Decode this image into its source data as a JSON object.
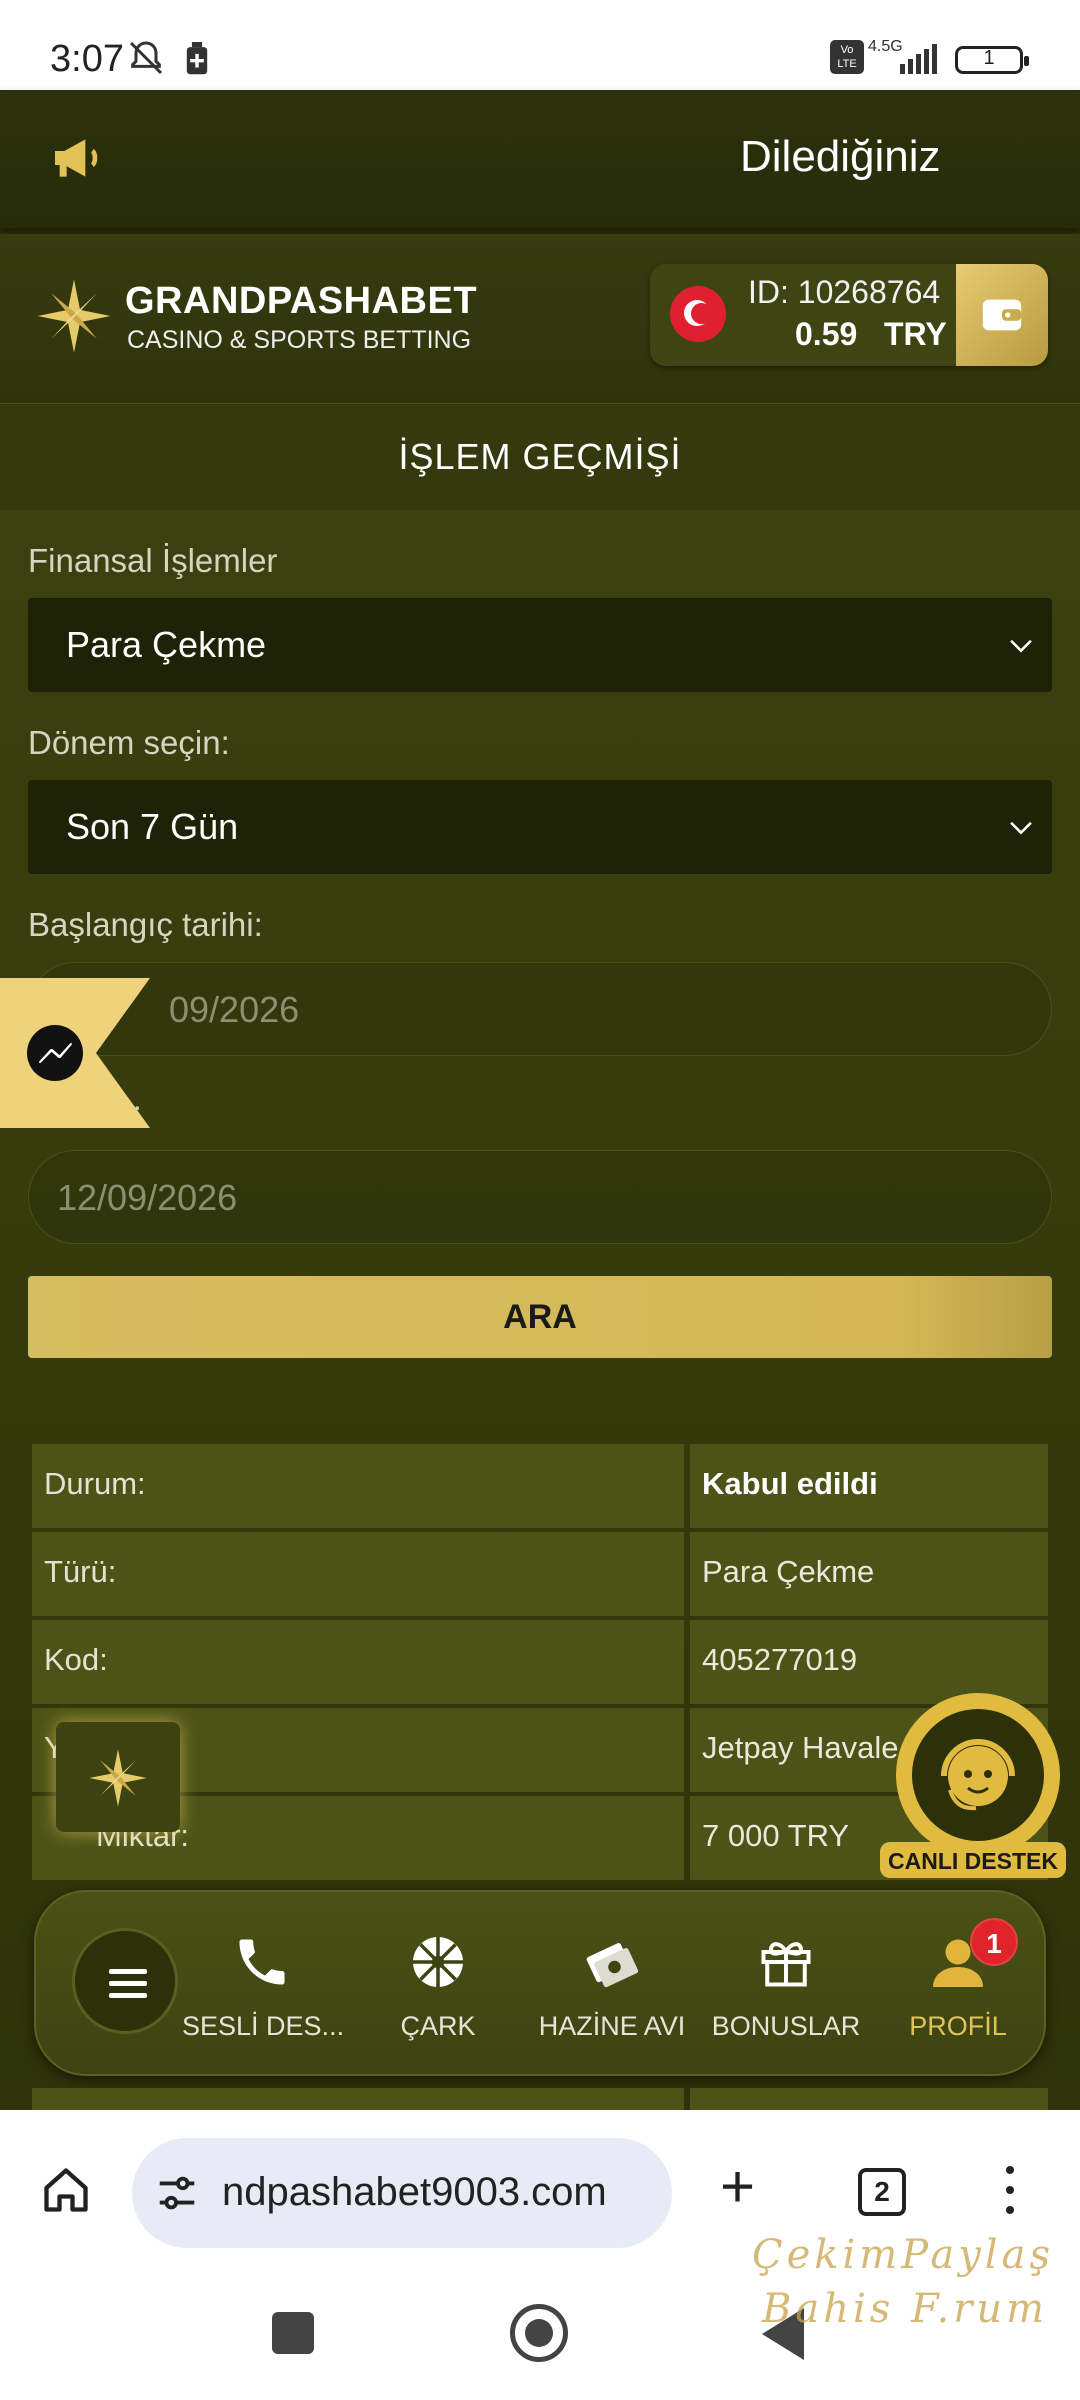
{
  "status_bar": {
    "time": "3:07",
    "network": "4.5G",
    "volte": "Vo LTE",
    "battery": "1"
  },
  "announcement": {
    "text": "Dilediğiniz"
  },
  "header": {
    "brand": "GRANDPASHABET",
    "tagline": "CASINO & SPORTS BETTING",
    "account_id": "ID: 10268764",
    "balance": "0.59",
    "currency": "TRY"
  },
  "page": {
    "title": "İŞLEM GEÇMİŞİ"
  },
  "filters": {
    "finance_label": "Finansal İşlemler",
    "finance_value": "Para Çekme",
    "period_label": "Dönem seçin:",
    "period_value": "Son 7 Gün",
    "start_label": "Başlangıç tarihi:",
    "start_value": "09/2026",
    "end_label": "rih:",
    "end_value": "12/09/2026",
    "search_button": "ARA"
  },
  "results": [
    {
      "label": "Durum:",
      "value": "Kabul edildi"
    },
    {
      "label": "Türü:",
      "value": "Para Çekme"
    },
    {
      "label": "Kod:",
      "value": "405277019"
    },
    {
      "label": "Y",
      "value": "Jetpay Havale"
    },
    {
      "label": "Miktar:",
      "value": "7 000 TRY"
    }
  ],
  "support": {
    "label": "CANLI DESTEK"
  },
  "bottom_nav": {
    "items": [
      {
        "label": "SESLİ DES...",
        "icon": "phone-icon"
      },
      {
        "label": "ÇARK",
        "icon": "wheel-icon"
      },
      {
        "label": "HAZİNE AVI",
        "icon": "treasure-icon"
      },
      {
        "label": "BONUSLAR",
        "icon": "gift-icon"
      },
      {
        "label": "PROFİL",
        "icon": "user-icon"
      }
    ],
    "profile_badge": "1"
  },
  "browser": {
    "url": "ndpashabet9003.com",
    "tab_count": "2"
  },
  "watermark": {
    "line1": "ÇekimPaylaş",
    "line2": "Bahis F.rum"
  },
  "colors": {
    "accent": "#d6bd5f",
    "background": "#2f340a",
    "badge": "#e0242b"
  }
}
